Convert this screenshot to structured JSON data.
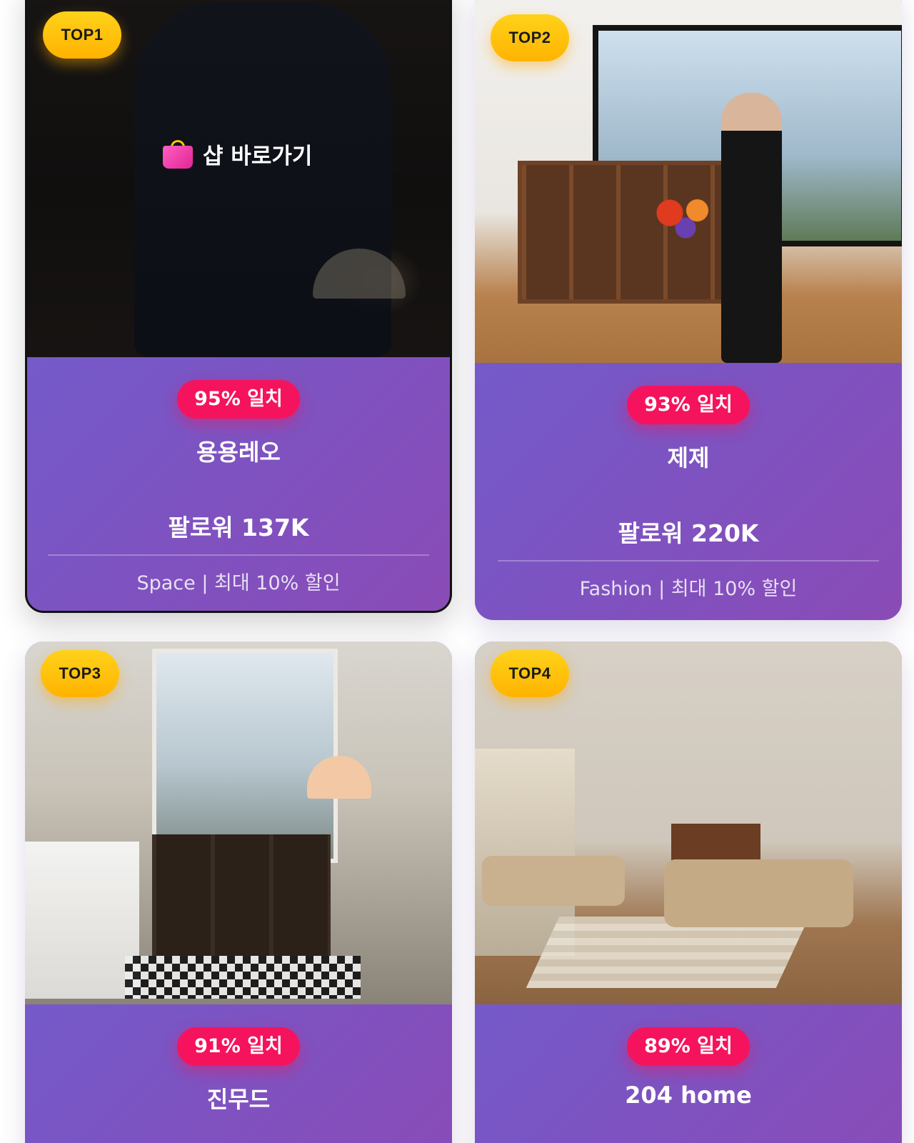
{
  "cards": [
    {
      "rank": "TOP1",
      "shop_link": "샵 바로가기",
      "match": "95% 일치",
      "name": "용용레오",
      "followers": "팔로워 137K",
      "category": "Space",
      "separator": "|",
      "discount": "최대 10% 할인"
    },
    {
      "rank": "TOP2",
      "match": "93% 일치",
      "name": "제제",
      "followers": "팔로워 220K",
      "category": "Fashion",
      "separator": "|",
      "discount": "최대 10% 할인"
    },
    {
      "rank": "TOP3",
      "match": "91% 일치",
      "name": "진무드"
    },
    {
      "rank": "TOP4",
      "match": "89% 일치",
      "name": "204 home"
    }
  ]
}
